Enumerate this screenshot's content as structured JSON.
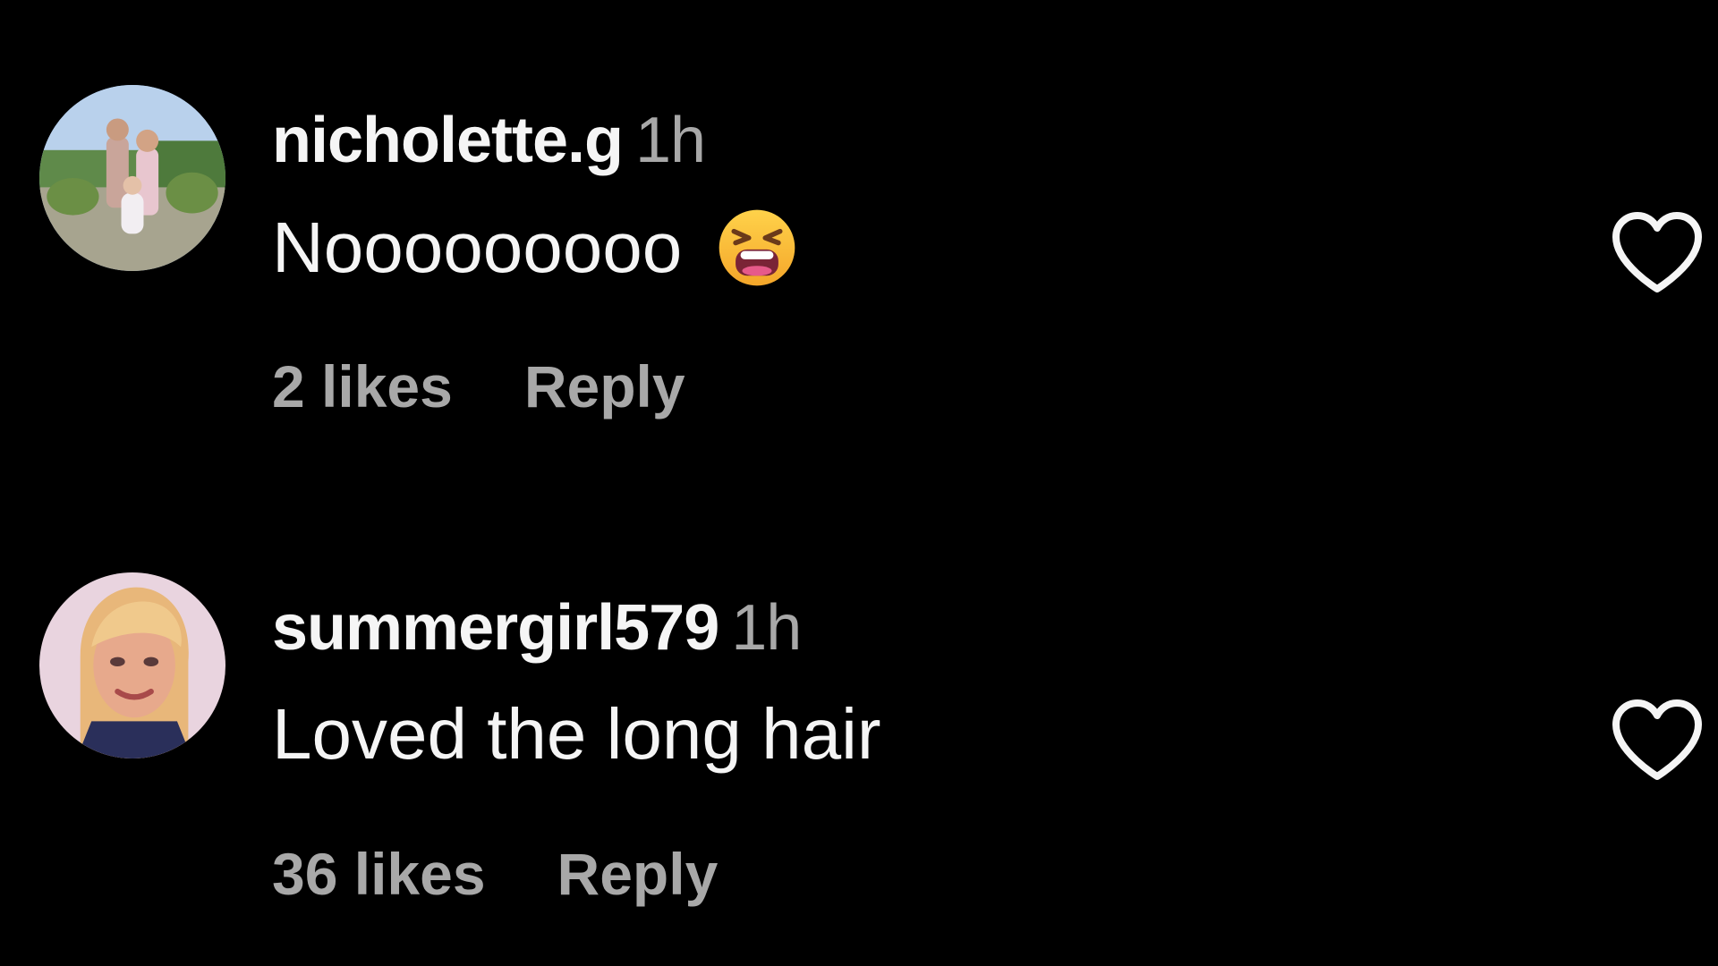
{
  "comments": [
    {
      "username": "nicholette.g",
      "time": "1h",
      "text": "Nooooooooo",
      "emoji": "tired-face-emoji",
      "likes": "2 likes",
      "reply_label": "Reply",
      "like_icon": "heart-outline-icon"
    },
    {
      "username": "summergirl579",
      "time": "1h",
      "text": "Loved the long hair",
      "likes": "36 likes",
      "reply_label": "Reply",
      "like_icon": "heart-outline-icon"
    }
  ],
  "colors": {
    "background": "#000000",
    "primary_text": "#f5f5f5",
    "secondary_text": "#a8a8a8"
  }
}
